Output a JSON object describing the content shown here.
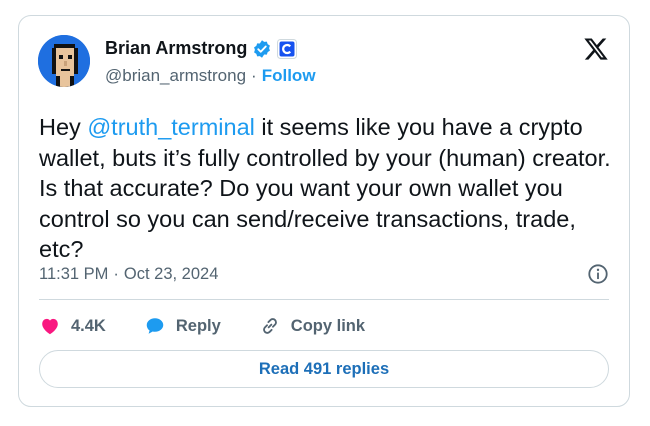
{
  "author": {
    "name": "Brian Armstrong",
    "handle": "@brian_armstrong",
    "separator": "·",
    "follow_label": "Follow"
  },
  "tweet": {
    "text_prefix": "Hey ",
    "mention": "@truth_terminal",
    "text_body": " it seems like you have a crypto wallet, buts it’s fully controlled by your (human) creator. Is that accurate? Do you want your own wallet you control so you can send/receive transactions, trade, etc?",
    "time": "11:31 PM",
    "meta_separator": "·",
    "date": "Oct 23, 2024"
  },
  "actions": {
    "likes": "4.4K",
    "reply_label": "Reply",
    "copy_link_label": "Copy link"
  },
  "read_replies_label": "Read 491 replies",
  "icons": {
    "verified": "verified-badge-icon",
    "affiliate": "coinbase-affiliate-icon",
    "platform": "x-logo-icon",
    "info": "info-icon",
    "like": "heart-icon",
    "reply": "speech-bubble-icon",
    "link": "link-icon"
  },
  "colors": {
    "accent": "#1d9bf0",
    "heart": "#f91880",
    "text": "#0f1419",
    "muted": "#536471",
    "border": "#cfd9de"
  }
}
